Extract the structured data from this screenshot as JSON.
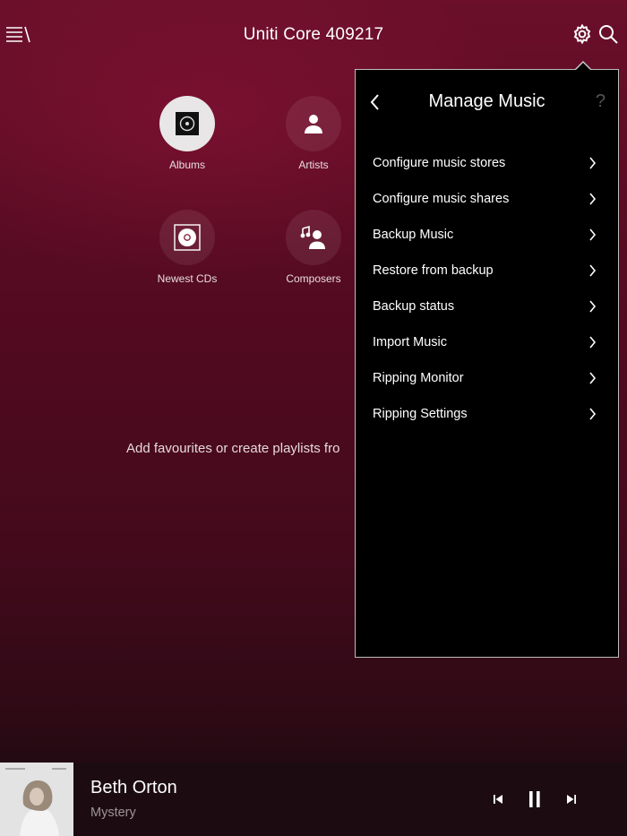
{
  "header": {
    "title": "Uniti Core 409217",
    "menu_icon": "hamburger-menu-icon",
    "settings_icon": "gear-icon",
    "search_icon": "search-icon"
  },
  "browse": {
    "tiles": [
      {
        "label": "Albums",
        "icon": "album-icon",
        "active": true
      },
      {
        "label": "Artists",
        "icon": "artist-icon",
        "active": false
      },
      {
        "label": "Newest CDs",
        "icon": "cd-icon",
        "active": false
      },
      {
        "label": "Composers",
        "icon": "composer-icon",
        "active": false
      }
    ],
    "hint": "Add favourites or create playlists fro"
  },
  "manage_panel": {
    "title": "Manage Music",
    "help": "?",
    "items": [
      {
        "label": "Configure music stores"
      },
      {
        "label": "Configure music shares"
      },
      {
        "label": "Backup Music"
      },
      {
        "label": "Restore from backup"
      },
      {
        "label": "Backup status"
      },
      {
        "label": "Import Music"
      },
      {
        "label": "Ripping Monitor"
      },
      {
        "label": "Ripping Settings"
      }
    ]
  },
  "now_playing": {
    "artist": "Beth Orton",
    "track": "Mystery",
    "state": "playing"
  },
  "colors": {
    "background_top": "#6b0f2a",
    "background_bottom": "#230a12",
    "panel_bg": "#000000",
    "panel_border": "#bdbdbd",
    "secondary_text": "#9d9396"
  }
}
